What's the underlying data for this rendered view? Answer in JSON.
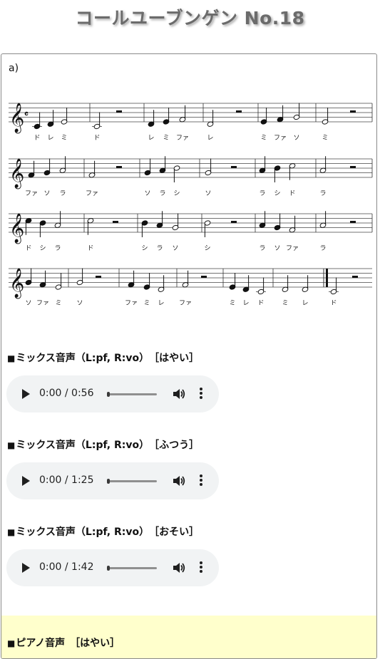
{
  "title": "コールユーブンゲン No.18",
  "exercise_label": "a)",
  "score": {
    "systems": [
      {
        "syllables": [
          "ド",
          "レ",
          "ミ",
          "ド",
          "レ",
          "ミ",
          "ファ",
          "レ",
          "ミ",
          "ファ",
          "ソ",
          "ミ"
        ]
      },
      {
        "syllables": [
          "ファ",
          "ソ",
          "ラ",
          "ファ",
          "ソ",
          "ラ",
          "シ",
          "ソ",
          "ラ",
          "シ",
          "ド",
          "ラ"
        ]
      },
      {
        "syllables": [
          "ド",
          "シ",
          "ラ",
          "ド",
          "シ",
          "ラ",
          "ソ",
          "シ",
          "ラ",
          "ソ",
          "ファ",
          "ラ"
        ]
      },
      {
        "syllables": [
          "ソ",
          "ファ",
          "ミ",
          "ソ",
          "ファ",
          "ミ",
          "レ",
          "ファ",
          "ミ",
          "レ",
          "ド",
          "ミ",
          "レ",
          "ド"
        ]
      }
    ]
  },
  "sections": [
    {
      "heading": "ミックス音声（L:pf, R:vo）　［はやい］",
      "time": "0:00 / 0:56"
    },
    {
      "heading": "ミックス音声（L:pf, R:vo）　［ふつう］",
      "time": "0:00 / 1:25"
    },
    {
      "heading": "ミックス音声（L:pf, R:vo）　［おそい］",
      "time": "0:00 / 1:42"
    }
  ],
  "piano_heading": "ピアノ音声　［はやい］",
  "bullet": "■",
  "icons": {
    "play": "play-icon",
    "volume": "volume-icon",
    "more": "more-options-icon",
    "treble_clef": "treble-clef-icon"
  },
  "colors": {
    "title": "#6b6b6b",
    "player_bg": "#f1f3f4",
    "piano_band": "#ffffcc"
  }
}
